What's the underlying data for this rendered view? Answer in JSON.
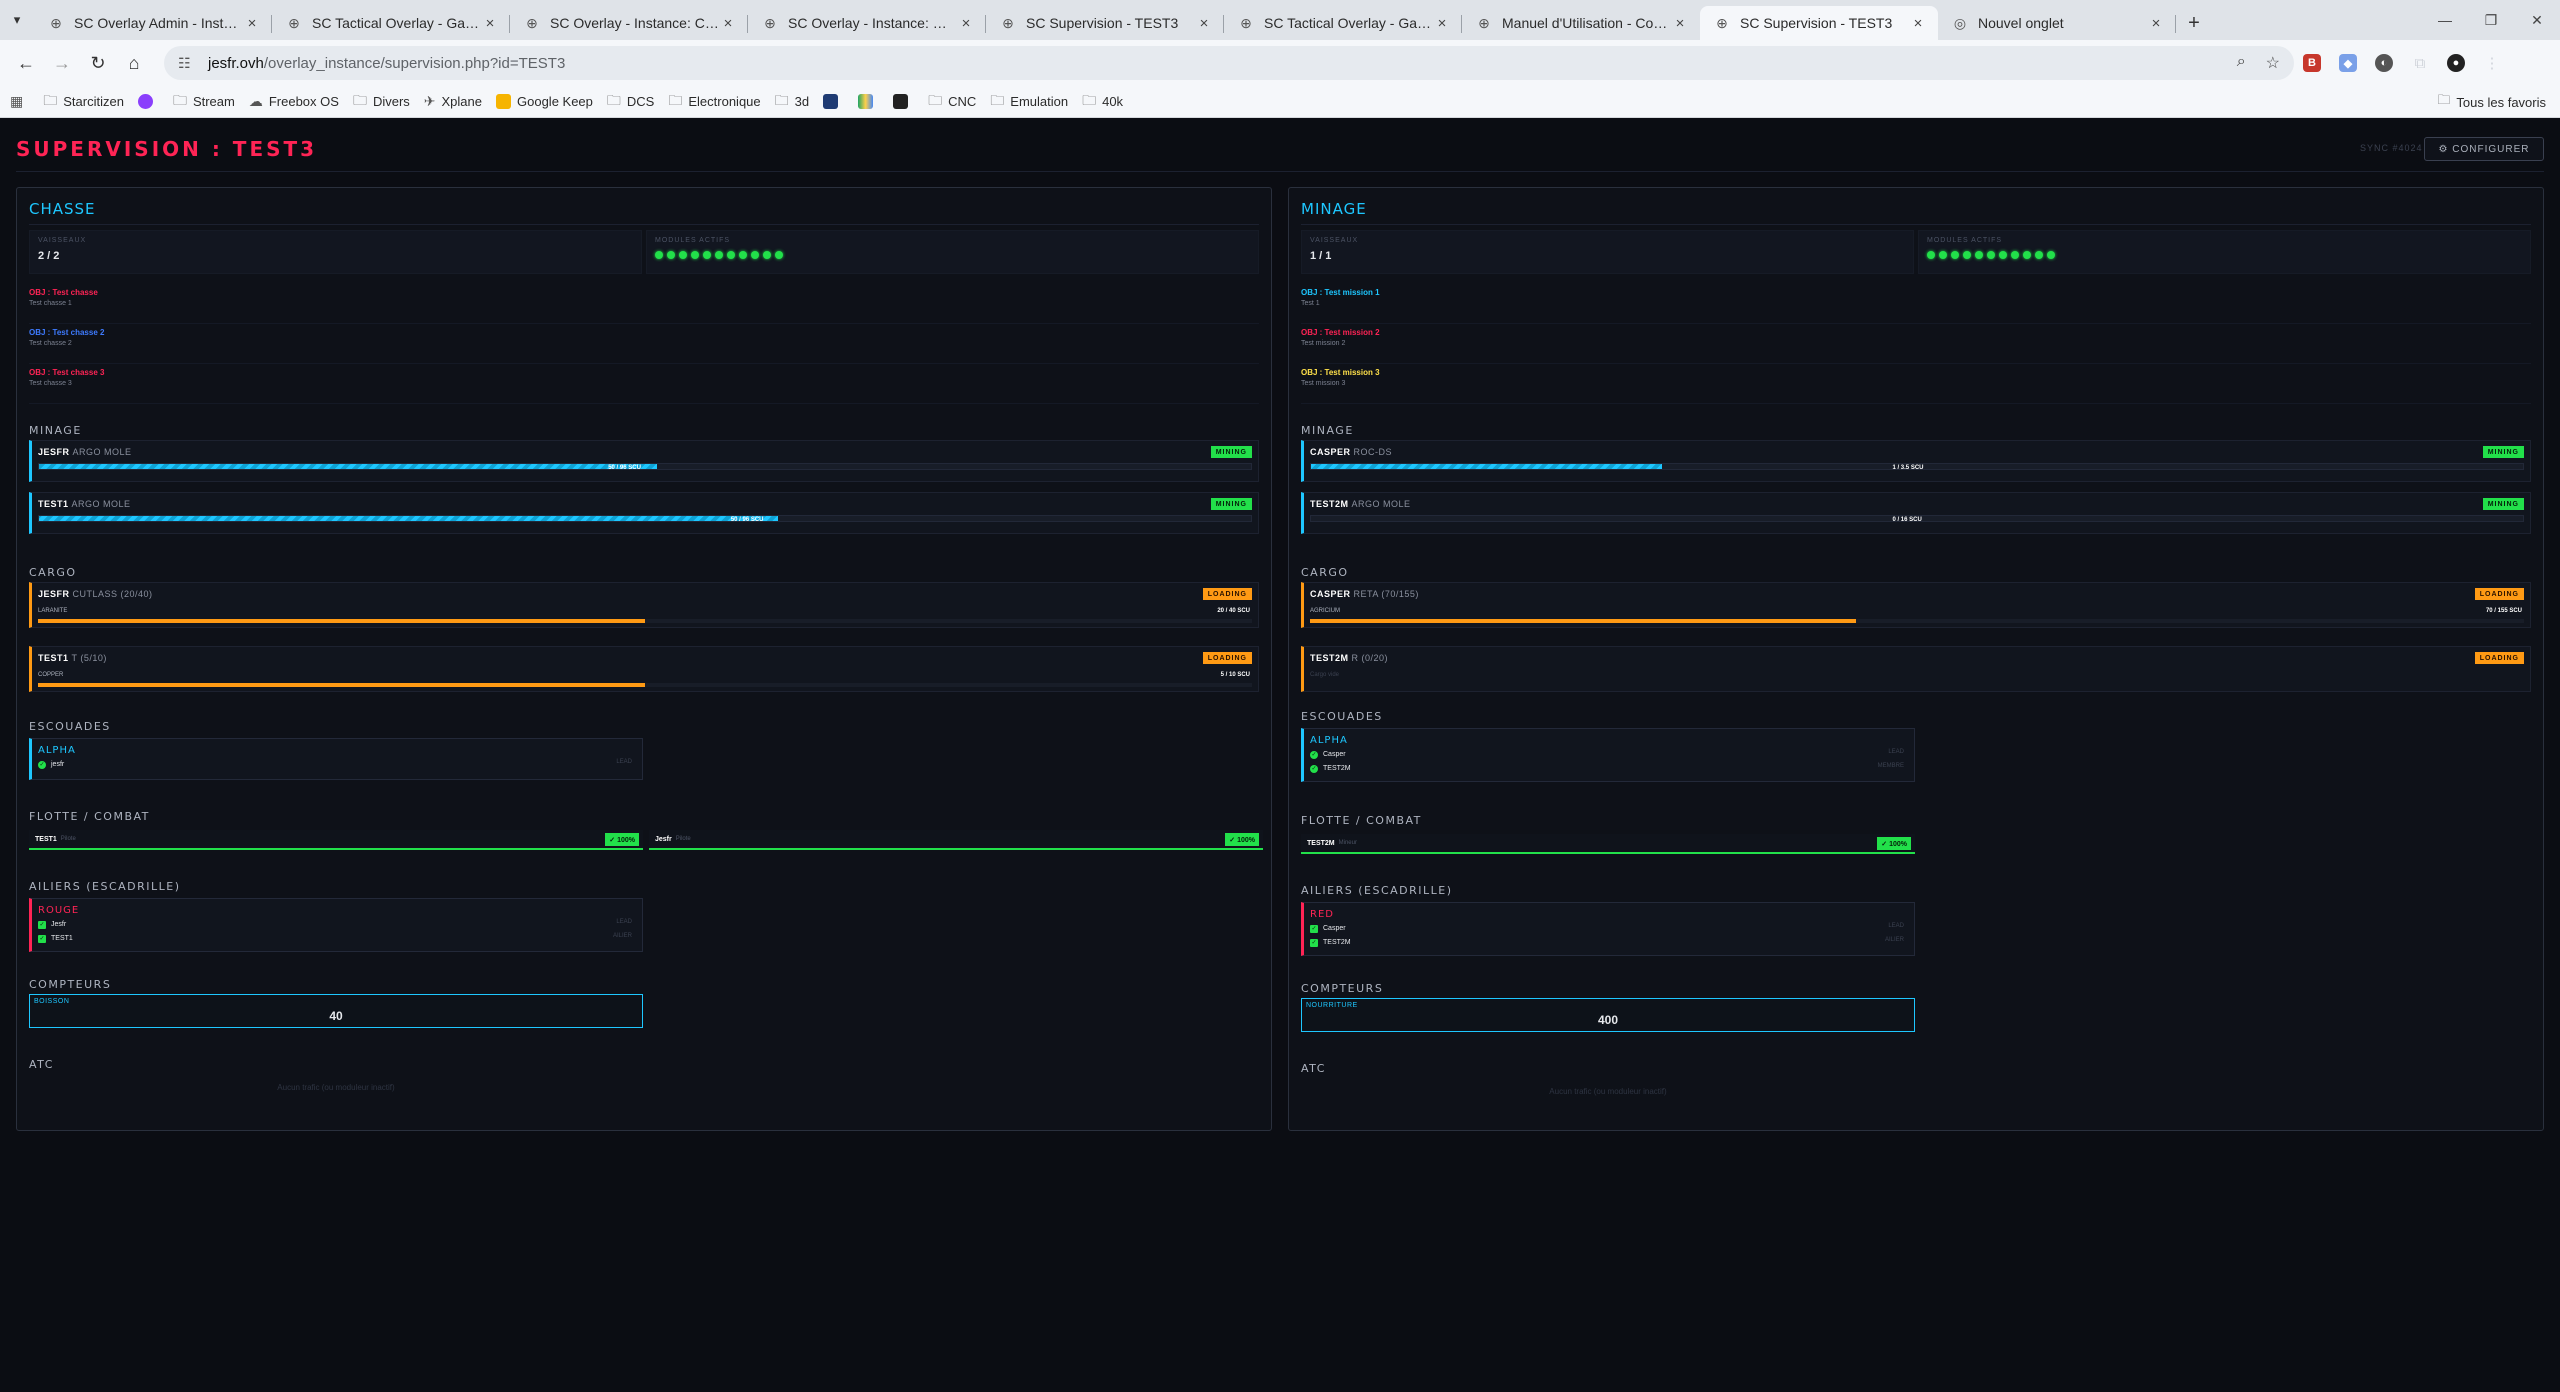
{
  "browser": {
    "tabs": [
      {
        "title": "SC Overlay Admin - Instance: C",
        "icon": "globe-icon"
      },
      {
        "title": "SC Tactical Overlay - Gateway",
        "icon": "globe-icon"
      },
      {
        "title": "SC Overlay - Instance: Chasse",
        "icon": "globe-icon"
      },
      {
        "title": "SC Overlay - Instance: Minage",
        "icon": "globe-icon"
      },
      {
        "title": "SC Supervision - TEST3",
        "icon": "globe-icon"
      },
      {
        "title": "SC Tactical Overlay - Gateway",
        "icon": "globe-icon"
      },
      {
        "title": "Manuel d'Utilisation - Comman",
        "icon": "globe-icon"
      },
      {
        "title": "SC Supervision - TEST3",
        "icon": "globe-icon",
        "active": true
      },
      {
        "title": "Nouvel onglet",
        "icon": "chrome-icon"
      }
    ],
    "url_host": "jesfr.ovh",
    "url_path": "/overlay_instance/supervision.php?id=TEST3",
    "bookmarks": [
      "Starcitizen",
      "",
      "Stream",
      "Freebox OS",
      "Divers",
      "Xplane",
      "Google Keep",
      "DCS",
      "Electronique",
      "3d",
      "",
      "",
      "",
      "CNC",
      "Emulation",
      "40k"
    ],
    "bookmarks_all": "Tous les favoris"
  },
  "page": {
    "title": "SUPERVISION : TEST3",
    "sync_label": "SYNC #4024",
    "configure_label": "⚙ CONFIGURER"
  },
  "colors": {
    "accent_cyan": "#1ec7ff",
    "accent_red": "#ff2455",
    "green": "#22e04a",
    "orange": "#ff9a14",
    "yellow": "#ffe14a",
    "blue": "#3e7bff"
  },
  "panels": [
    {
      "name": "CHASSE",
      "ships_label": "VAISSEAUX",
      "ships_value": "2 / 2",
      "modules_label": "MODULES ACTIFS",
      "modules_count": 11,
      "objectives": [
        {
          "title": "OBJ : Test chasse",
          "sub": "Test chasse 1",
          "color": "#ff2455"
        },
        {
          "title": "OBJ : Test chasse 2",
          "sub": "Test chasse 2",
          "color": "#3e7bff"
        },
        {
          "title": "OBJ : Test chasse 3",
          "sub": "Test chasse 3",
          "color": "#ff2455"
        }
      ],
      "sections": {
        "mining": "MINAGE",
        "cargo": "CARGO",
        "squads": "ESCOUADES",
        "fleet": "FLOTTE / COMBAT",
        "wingmen": "AILIERS (ESCADRILLE)",
        "counters": "COMPTEURS",
        "atc": "ATC"
      },
      "mining": [
        {
          "name": "JESFR",
          "model": "ARGO MOLE",
          "status": "MINING",
          "progress": 0.51,
          "label": "50 / 96 SCU"
        },
        {
          "name": "TEST1",
          "model": "ARGO MOLE",
          "status": "MINING",
          "progress": 0.61,
          "label": "50 / 96 SCU"
        }
      ],
      "cargo": [
        {
          "name": "JESFR",
          "model": "CUTLASS (20/40)",
          "status": "LOADING",
          "sub": "LARANITE",
          "progress": 0.5,
          "label": "20 / 40 SCU"
        },
        {
          "name": "TEST1",
          "model": "T (5/10)",
          "status": "LOADING",
          "sub": "COPPER",
          "progress": 0.5,
          "label": "5 / 10 SCU"
        }
      ],
      "squads": [
        {
          "name": "ALPHA",
          "members": [
            {
              "name": "jesfr",
              "role": "LEAD"
            }
          ]
        }
      ],
      "fleet": [
        {
          "name": "TEST1",
          "role": "Pilote",
          "badge": "✓ 100%"
        },
        {
          "name": "Jesfr",
          "role": "Pilote",
          "badge": "✓ 100%"
        }
      ],
      "wingmen": [
        {
          "name": "ROUGE",
          "members": [
            {
              "name": "Jesfr",
              "role": "LEAD"
            },
            {
              "name": "TEST1",
              "role": "AILIER"
            }
          ]
        }
      ],
      "counters": [
        {
          "label": "BOISSON",
          "value": "40"
        }
      ],
      "atc_empty": "Aucun trafic (ou moduleur inactif)"
    },
    {
      "name": "MINAGE",
      "ships_label": "VAISSEAUX",
      "ships_value": "1 / 1",
      "modules_label": "MODULES ACTIFS",
      "modules_count": 11,
      "objectives": [
        {
          "title": "OBJ : Test mission 1",
          "sub": "Test 1",
          "color": "#1ec7ff"
        },
        {
          "title": "OBJ : Test mission 2",
          "sub": "Test mission 2",
          "color": "#ff2455"
        },
        {
          "title": "OBJ : Test mission 3",
          "sub": "Test mission 3",
          "color": "#ffe14a"
        }
      ],
      "sections": {
        "mining": "MINAGE",
        "cargo": "CARGO",
        "squads": "ESCOUADES",
        "fleet": "FLOTTE / COMBAT",
        "wingmen": "AILIERS (ESCADRILLE)",
        "counters": "COMPTEURS",
        "atc": "ATC"
      },
      "mining": [
        {
          "name": "CASPER",
          "model": "ROC-DS",
          "status": "MINING",
          "progress": 0.29,
          "label": "1 / 3.5 SCU"
        },
        {
          "name": "TEST2M",
          "model": "ARGO MOLE",
          "status": "MINING",
          "progress": 0.0,
          "label": "0 / 16 SCU"
        }
      ],
      "cargo": [
        {
          "name": "CASPER",
          "model": "RETA (70/155)",
          "status": "LOADING",
          "sub": "AGRICIUM",
          "progress": 0.45,
          "label": "70 / 155 SCU"
        },
        {
          "name": "TEST2M",
          "model": "R (0/20)",
          "status": "LOADING",
          "sub": "Cargo vide",
          "progress": 0.0,
          "label": ""
        }
      ],
      "squads": [
        {
          "name": "ALPHA",
          "members": [
            {
              "name": "Casper",
              "role": "LEAD"
            },
            {
              "name": "TEST2M",
              "role": "MEMBRE"
            }
          ]
        }
      ],
      "fleet": [
        {
          "name": "TEST2M",
          "role": "Mineur",
          "badge": "✓ 100%"
        }
      ],
      "wingmen": [
        {
          "name": "RED",
          "members": [
            {
              "name": "Casper",
              "role": "LEAD"
            },
            {
              "name": "TEST2M",
              "role": "AILIER"
            }
          ]
        }
      ],
      "counters": [
        {
          "label": "NOURRITURE",
          "value": "400"
        }
      ],
      "atc_empty": "Aucun trafic (ou moduleur inactif)"
    }
  ]
}
